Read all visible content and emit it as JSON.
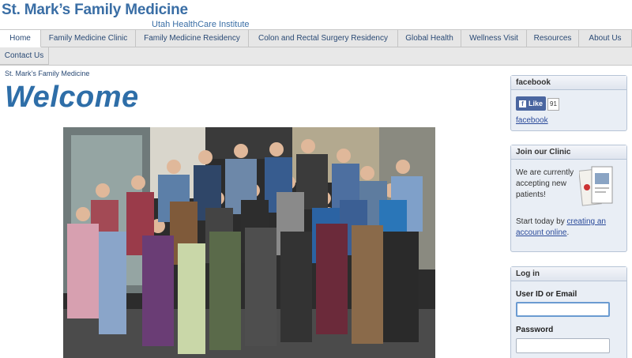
{
  "header": {
    "title": "St. Mark’s Family Medicine",
    "subtitle": "Utah HealthCare Institute"
  },
  "nav": {
    "tabs": [
      {
        "label": "Home",
        "active": true
      },
      {
        "label": "Family Medicine Clinic"
      },
      {
        "label": "Family Medicine Residency"
      },
      {
        "label": "Colon and Rectal Surgery Residency"
      },
      {
        "label": "Global Health"
      },
      {
        "label": "Wellness Visit"
      },
      {
        "label": "Resources"
      },
      {
        "label": "About Us"
      },
      {
        "label": "Contact Us"
      }
    ]
  },
  "main": {
    "breadcrumb": "St. Mark’s Family Medicine",
    "title": "Welcome"
  },
  "sidebar": {
    "facebook": {
      "header": "facebook",
      "like_label": "Like",
      "count": "91",
      "link": "facebook"
    },
    "join": {
      "header": "Join our Clinic",
      "text": "We are currently accepting new patients!",
      "cta_prefix": "Start today by ",
      "cta_link": "creating an account online",
      "cta_suffix": "."
    },
    "login": {
      "header": "Log in",
      "user_label": "User ID or Email",
      "password_label": "Password"
    }
  },
  "colors": {
    "brand": "#3a6ea5",
    "title": "#2e6ea8",
    "facebook": "#4a66a0"
  }
}
